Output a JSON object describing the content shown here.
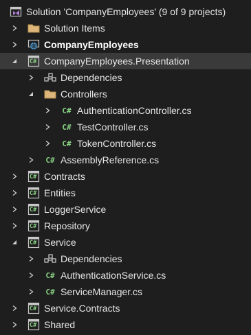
{
  "explorer": {
    "items": [
      {
        "label": "Solution 'CompanyEmployees' (9 of 9 projects)",
        "icon": "solution-icon",
        "arrow": "none",
        "level": 0
      },
      {
        "label": "Solution Items",
        "icon": "folder-icon",
        "arrow": "collapsed",
        "level": 1
      },
      {
        "label": "CompanyEmployees",
        "icon": "web-project-icon",
        "arrow": "collapsed",
        "level": 1,
        "bold": true
      },
      {
        "label": "CompanyEmployees.Presentation",
        "icon": "csharp-project-icon",
        "arrow": "expanded",
        "level": 1,
        "selected": true
      },
      {
        "label": "Dependencies",
        "icon": "dependencies-icon",
        "arrow": "collapsed",
        "level": 2
      },
      {
        "label": "Controllers",
        "icon": "folder-icon",
        "arrow": "expanded",
        "level": 2
      },
      {
        "label": "AuthenticationController.cs",
        "icon": "csharp-file-icon",
        "arrow": "collapsed",
        "level": 3
      },
      {
        "label": "TestController.cs",
        "icon": "csharp-file-icon",
        "arrow": "collapsed",
        "level": 3
      },
      {
        "label": "TokenController.cs",
        "icon": "csharp-file-icon",
        "arrow": "collapsed",
        "level": 3
      },
      {
        "label": "AssemblyReference.cs",
        "icon": "csharp-file-icon",
        "arrow": "collapsed",
        "level": 2
      },
      {
        "label": "Contracts",
        "icon": "csharp-project-icon",
        "arrow": "collapsed",
        "level": 1
      },
      {
        "label": "Entities",
        "icon": "csharp-project-icon",
        "arrow": "collapsed",
        "level": 1
      },
      {
        "label": "LoggerService",
        "icon": "csharp-project-icon",
        "arrow": "collapsed",
        "level": 1
      },
      {
        "label": "Repository",
        "icon": "csharp-project-icon",
        "arrow": "collapsed",
        "level": 1
      },
      {
        "label": "Service",
        "icon": "csharp-project-icon",
        "arrow": "expanded",
        "level": 1
      },
      {
        "label": "Dependencies",
        "icon": "dependencies-icon",
        "arrow": "collapsed",
        "level": 2
      },
      {
        "label": "AuthenticationService.cs",
        "icon": "csharp-file-icon",
        "arrow": "collapsed",
        "level": 2
      },
      {
        "label": "ServiceManager.cs",
        "icon": "csharp-file-icon",
        "arrow": "collapsed",
        "level": 2
      },
      {
        "label": "Service.Contracts",
        "icon": "csharp-project-icon",
        "arrow": "collapsed",
        "level": 1
      },
      {
        "label": "Shared",
        "icon": "csharp-project-icon",
        "arrow": "collapsed",
        "level": 1
      }
    ]
  },
  "icon_glyphs": {
    "csharp": "C#"
  },
  "colors": {
    "background": "#1e1e1e",
    "selected_row": "#3a3a3a",
    "folder": "#dcb67a",
    "csharp_green": "#89d185",
    "solution_purple": "#b180d7",
    "web_blue": "#4fa3e3"
  }
}
